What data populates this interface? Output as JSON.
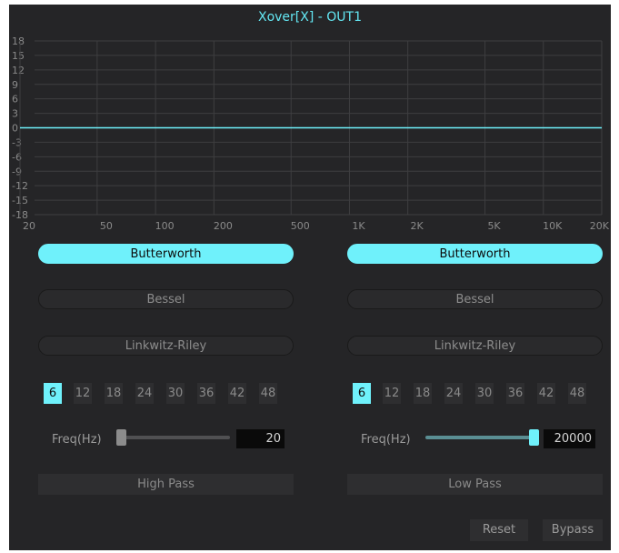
{
  "window": {
    "title": "Xover[X] - OUT1"
  },
  "graph": {
    "db_ticks": [
      "18",
      "15",
      "12",
      "9",
      "6",
      "3",
      "0",
      "-3",
      "-6",
      "-9",
      "-12",
      "-15",
      "-18"
    ],
    "freq_ticks": [
      "20",
      "50",
      "100",
      "200",
      "500",
      "1K",
      "2K",
      "5K",
      "10K",
      "20K"
    ],
    "response_db": 0,
    "line_color": "#6ff1fb",
    "grid_color": "#3e3e40"
  },
  "high_pass": {
    "filter_types": [
      "Butterworth",
      "Bessel",
      "Linkwitz-Riley"
    ],
    "selected_type": "Butterworth",
    "slopes": [
      "6",
      "12",
      "18",
      "24",
      "30",
      "36",
      "42",
      "48"
    ],
    "selected_slope": "6",
    "freq_label": "Freq(Hz)",
    "freq_value": "20",
    "slider_fraction": 0,
    "footer_label": "High Pass"
  },
  "low_pass": {
    "filter_types": [
      "Butterworth",
      "Bessel",
      "Linkwitz-Riley"
    ],
    "selected_type": "Butterworth",
    "slopes": [
      "6",
      "12",
      "18",
      "24",
      "30",
      "36",
      "42",
      "48"
    ],
    "selected_slope": "6",
    "freq_label": "Freq(Hz)",
    "freq_value": "20000",
    "slider_fraction": 1,
    "footer_label": "Low Pass"
  },
  "actions": {
    "reset_label": "Reset",
    "bypass_label": "Bypass"
  },
  "colors": {
    "accent": "#6ff1fb",
    "background": "#252527",
    "title": "#63e6f2"
  }
}
